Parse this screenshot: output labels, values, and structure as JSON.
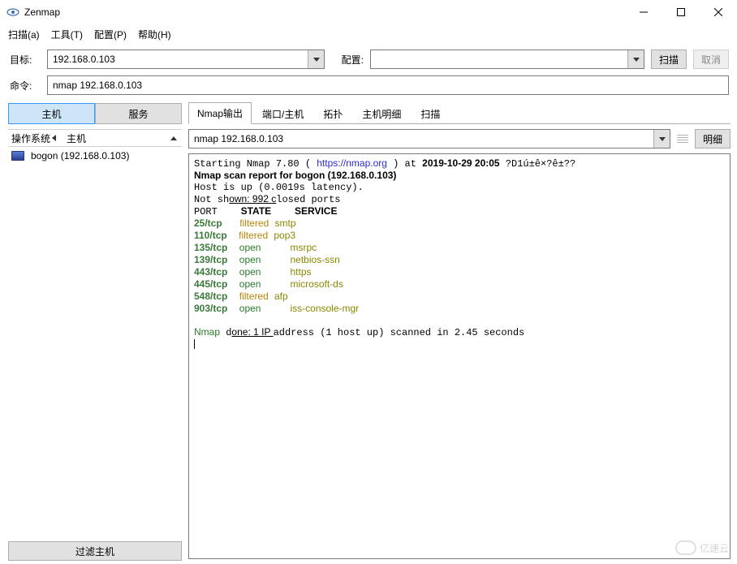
{
  "window": {
    "title": "Zenmap"
  },
  "menu": {
    "scan": "扫描(a)",
    "tools": "工具(T)",
    "config": "配置(P)",
    "help": "帮助(H)"
  },
  "form": {
    "target_label": "目标:",
    "target_value": "192.168.0.103",
    "profile_label": "配置:",
    "profile_value": "",
    "scan_btn": "扫描",
    "cancel_btn": "取消",
    "cmd_label": "命令:",
    "cmd_value": "nmap 192.168.0.103"
  },
  "left": {
    "tab_hosts": "主机",
    "tab_services": "服务",
    "col_os": "操作系统",
    "col_host": "主机",
    "hosts": [
      {
        "name": "bogon (192.168.0.103)"
      }
    ],
    "filter_btn": "过滤主机"
  },
  "tabs": {
    "output": "Nmap输出",
    "ports": "端口/主机",
    "topo": "拓扑",
    "detail": "主机明细",
    "scans": "扫描"
  },
  "outbar": {
    "combo_value": "nmap 192.168.0.103",
    "detail_btn": "明细"
  },
  "nmap": {
    "start_prefix": "Starting Nmap 7.80 ( ",
    "url": "https://nmap.org",
    "start_mid": " ) at ",
    "date": "2019-10-29 20:05",
    "start_suffix": " ?D1ú±ê×?ê±??",
    "report": "Nmap scan report for bogon (192.168.0.103)",
    "hostup": "Host is up (0.0019s latency).",
    "notshown_a": "Not sh",
    "notshown_u": "own: 992 c",
    "notshown_b": "losed ports",
    "hdr_port": "PORT",
    "hdr_state": "STATE",
    "hdr_service": "SERVICE",
    "rows": [
      {
        "port": "25/tcp",
        "pad": "  ",
        "state": "filtered",
        "svc": "smtp"
      },
      {
        "port": "110/tcp",
        "pad": " ",
        "state": "filtered",
        "svc": "pop3"
      },
      {
        "port": "135/tcp",
        "pad": " ",
        "state": "open",
        "svc": "msrpc"
      },
      {
        "port": "139/tcp",
        "pad": " ",
        "state": "open",
        "svc": "netbios-ssn"
      },
      {
        "port": "443/tcp",
        "pad": " ",
        "state": "open",
        "svc": "https"
      },
      {
        "port": "445/tcp",
        "pad": " ",
        "state": "open",
        "svc": "microsoft-ds"
      },
      {
        "port": "548/tcp",
        "pad": " ",
        "state": "filtered",
        "svc": "afp"
      },
      {
        "port": "903/tcp",
        "pad": " ",
        "state": "open",
        "svc": "iss-console-mgr"
      }
    ],
    "done_a": "Nmap d",
    "done_u": "one: 1 IP ",
    "done_b": "address (1 host up) scanned in 2.45 seconds"
  },
  "watermark": "亿速云"
}
